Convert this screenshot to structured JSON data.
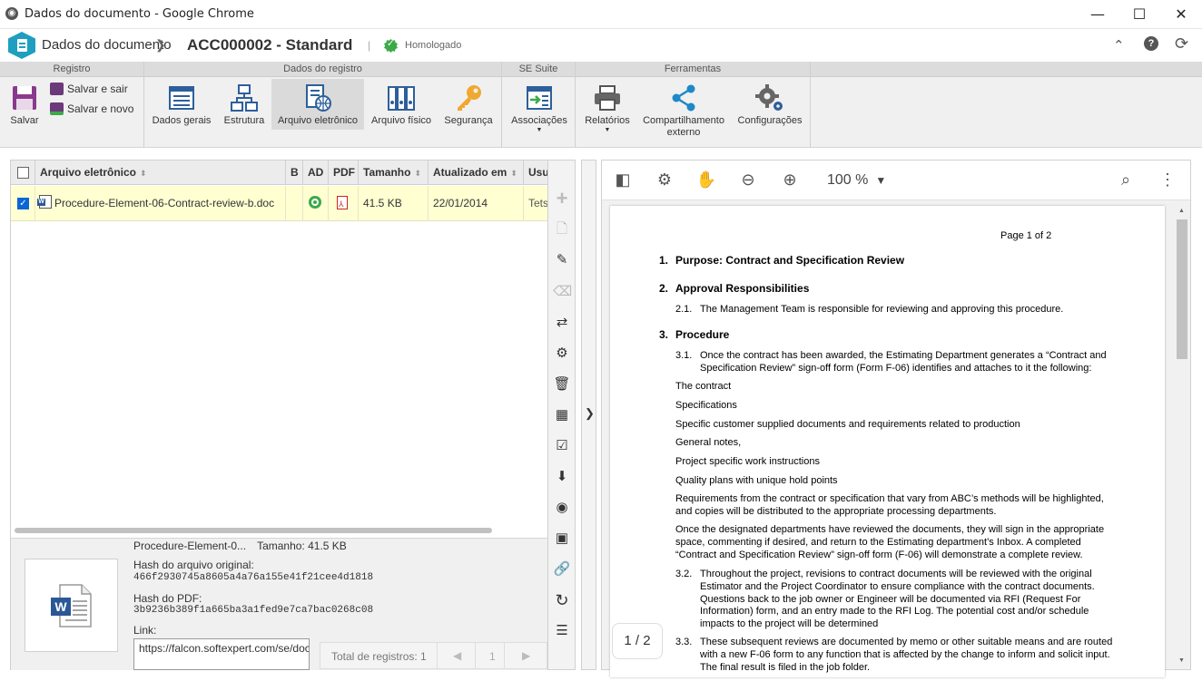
{
  "window": {
    "title": "Dados do documento - Google Chrome"
  },
  "header": {
    "breadcrumb": "Dados do documento",
    "doc_id": "ACC000002 - Standard",
    "status": "Homologado"
  },
  "ribbon": {
    "groups": {
      "registro": "Registro",
      "dados": "Dados do registro",
      "suite": "SE Suite",
      "ferramentas": "Ferramentas"
    },
    "salvar": "Salvar",
    "salvar_sair": "Salvar e sair",
    "salvar_novo": "Salvar e novo",
    "dados_gerais": "Dados gerais",
    "estrutura": "Estrutura",
    "arquivo_eletronico": "Arquivo eletrônico",
    "arquivo_fisico": "Arquivo físico",
    "seguranca": "Segurança",
    "associacoes": "Associações",
    "relatorios": "Relatórios",
    "compartilhamento1": "Compartilhamento",
    "compartilhamento2": "externo",
    "configuracoes": "Configurações"
  },
  "grid": {
    "columns": [
      "Arquivo eletrônico",
      "B",
      "AD",
      "PDF",
      "Tamanho",
      "Atualizado em",
      "Usu"
    ],
    "rows": [
      {
        "file": "Procedure-Element-06-Contract-review-b.doc",
        "size": "41.5 KB",
        "updated": "22/01/2014",
        "user": "Tets"
      }
    ]
  },
  "details": {
    "name": "Procedure-Element-0...",
    "size_label": "Tamanho: 41.5 KB",
    "hash_orig_label": "Hash do arquivo original:",
    "hash_orig": "466f2930745a8605a4a76a155e41f21cee4d1818",
    "hash_pdf_label": "Hash do PDF:",
    "hash_pdf": "3b9236b389f1a665ba3a1fed9e7ca7bac0268c08",
    "link_label": "Link:",
    "link_value": "https://falcon.softexpert.com/se/document/dc_view_docume"
  },
  "pager": {
    "total": "Total de registros: 1",
    "page": "1"
  },
  "viewer": {
    "zoom": "100 %",
    "page_indicator": "1 / 2",
    "doc": {
      "page_of": "Page 1 of 2",
      "h1": "1.",
      "h1t": "Purpose: Contract and Specification Review",
      "h2": "2.",
      "h2t": "Approval Responsibilities",
      "p21n": "2.1.",
      "p21": "The Management Team is responsible for reviewing and approving this procedure.",
      "h3": "3.",
      "h3t": "Procedure",
      "p31n": "3.1.",
      "p31a": "Once the contract has been awarded, the Estimating Department generates a “Contract and",
      "p31b": "Specification Review” sign-off form (Form F-06) identifies and attaches to it the following:",
      "i1": "The contract",
      "i2": "Specifications",
      "i3": "Specific customer supplied documents and requirements related to production",
      "i4": "General notes,",
      "i5": "Project specific work instructions",
      "i6": "Quality plans with unique hold points",
      "r1": "Requirements from the contract or specification that vary from ABC’s methods will be highlighted,",
      "r2": "and copies will be distributed to the appropriate processing departments.",
      "o1": "Once the designated departments have reviewed the documents, they will sign in the appropriate",
      "o2": "space, commenting if desired, and return to the Estimating department’s Inbox. A completed",
      "o3": "“Contract and Specification Review” sign-off form (F-06) will demonstrate a complete review.",
      "p32n": "3.2.",
      "p32a": "Throughout the project, revisions to contract documents will be reviewed with the original",
      "p32b": "Estimator and the Project Coordinator to ensure compliance with the contract documents.",
      "p32c": "Questions back to the job owner or Engineer will be documented via RFI (Request For",
      "p32d": "Information) form, and an entry made to the RFI Log. The potential cost and/or schedule",
      "p32e": "impacts to the project will be determined",
      "p33n": "3.3.",
      "p33a": "These subsequent reviews are documented by memo or other suitable means and are routed",
      "p33b": "with a new F-06 form to any function that is affected by the change to inform and solicit input.",
      "p33c": "The final result is filed in the job folder."
    }
  },
  "colors": {
    "accent": "#1e9fbf",
    "selected_row": "#ffffd2",
    "approved": "#3caa49"
  }
}
